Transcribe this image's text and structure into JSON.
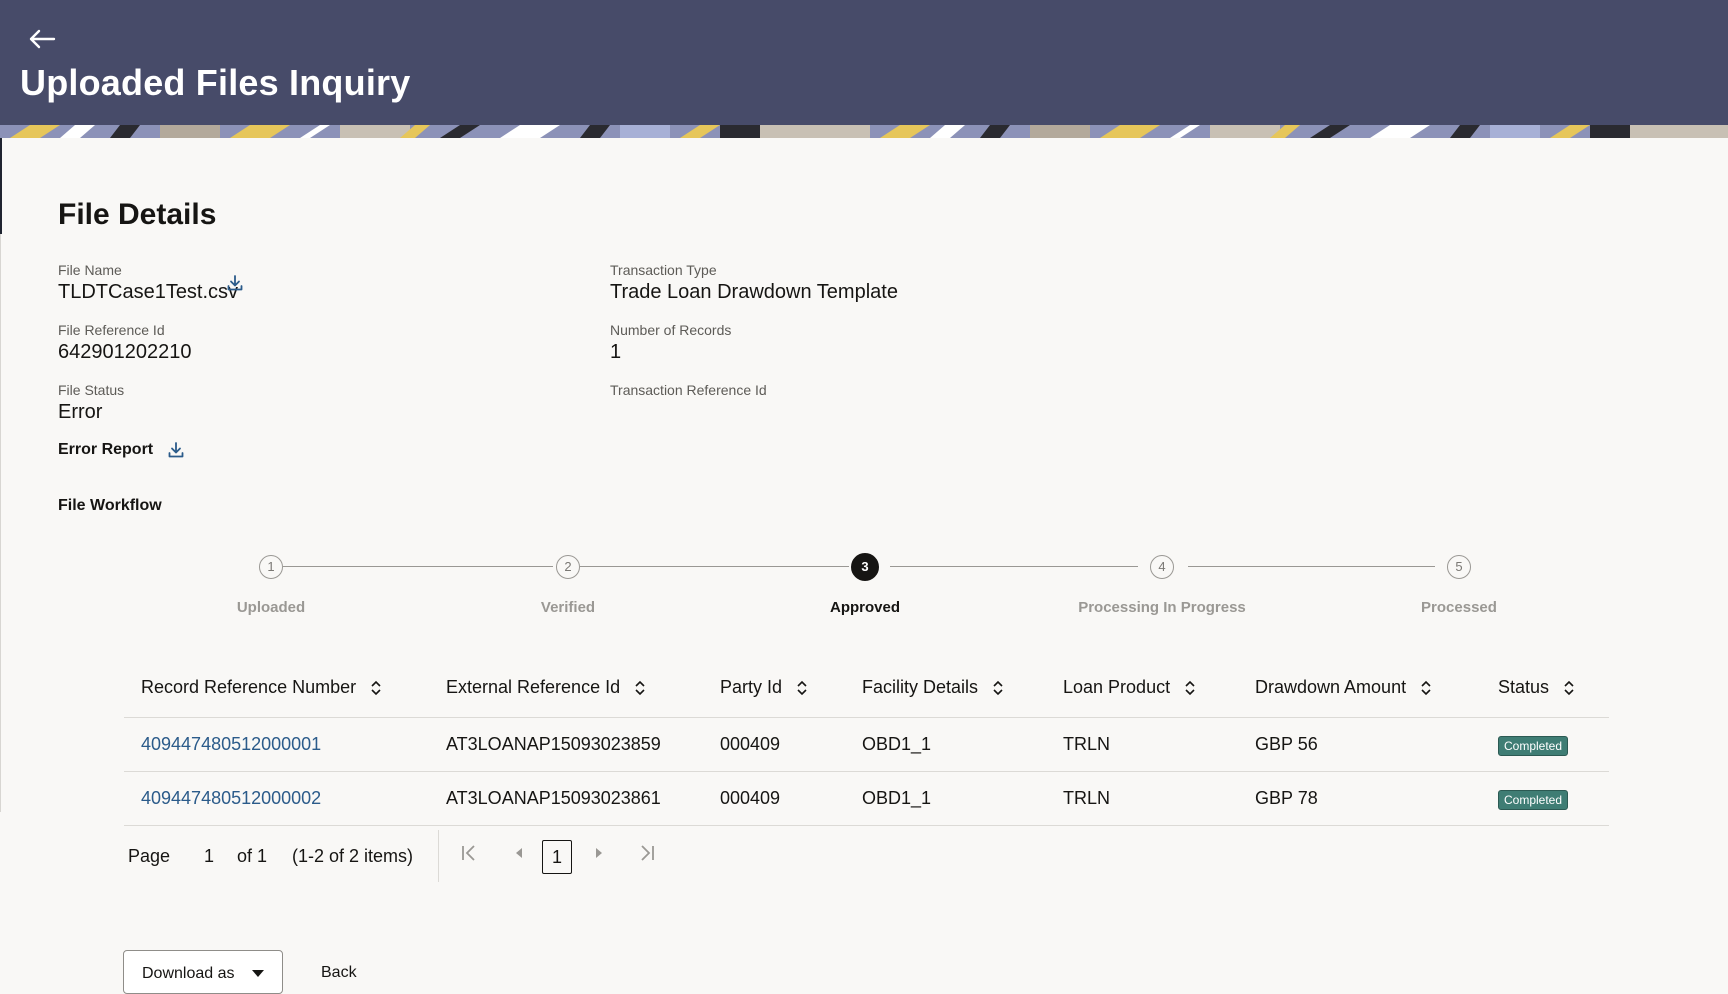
{
  "header": {
    "title": "Uploaded Files Inquiry",
    "back_icon": "arrow-left-icon",
    "background": "#474b69"
  },
  "file_details": {
    "title": "File Details",
    "file_name_label": "File Name",
    "file_name": "TLDTCase1Test.csv",
    "transaction_type_label": "Transaction Type",
    "transaction_type": "Trade Loan Drawdown Template",
    "file_reference_label": "File Reference Id",
    "file_reference": "642901202210",
    "number_of_records_label": "Number of Records",
    "number_of_records": "1",
    "file_status_label": "File Status",
    "file_status": "Error",
    "transaction_reference_label": "Transaction Reference Id",
    "error_report_label": "Error Report",
    "download_icon": "download-icon"
  },
  "workflow": {
    "title": "File Workflow",
    "current_step": 3,
    "steps": [
      {
        "number": "1",
        "label": "Uploaded"
      },
      {
        "number": "2",
        "label": "Verified"
      },
      {
        "number": "3",
        "label": "Approved"
      },
      {
        "number": "4",
        "label": "Processing In Progress"
      },
      {
        "number": "5",
        "label": "Processed"
      }
    ]
  },
  "table": {
    "columns": [
      "Record Reference Number",
      "External Reference Id",
      "Party Id",
      "Facility Details",
      "Loan Product",
      "Drawdown Amount",
      "Status"
    ],
    "rows": [
      {
        "record_reference": "409447480512000001",
        "external_reference": "AT3LOANAP15093023859",
        "party_id": "000409",
        "facility": "OBD1_1",
        "loan_product": "TRLN",
        "amount": "GBP 56",
        "status": "Completed"
      },
      {
        "record_reference": "409447480512000002",
        "external_reference": "AT3LOANAP15093023861",
        "party_id": "000409",
        "facility": "OBD1_1",
        "loan_product": "TRLN",
        "amount": "GBP 78",
        "status": "Completed"
      }
    ],
    "status_color": "#3f7d74"
  },
  "pagination": {
    "page_label": "Page",
    "page_value": "1",
    "of_label": "of 1",
    "items_label": "(1-2 of 2 items)",
    "current_page": "1"
  },
  "actions": {
    "download_as": "Download as",
    "back": "Back"
  }
}
